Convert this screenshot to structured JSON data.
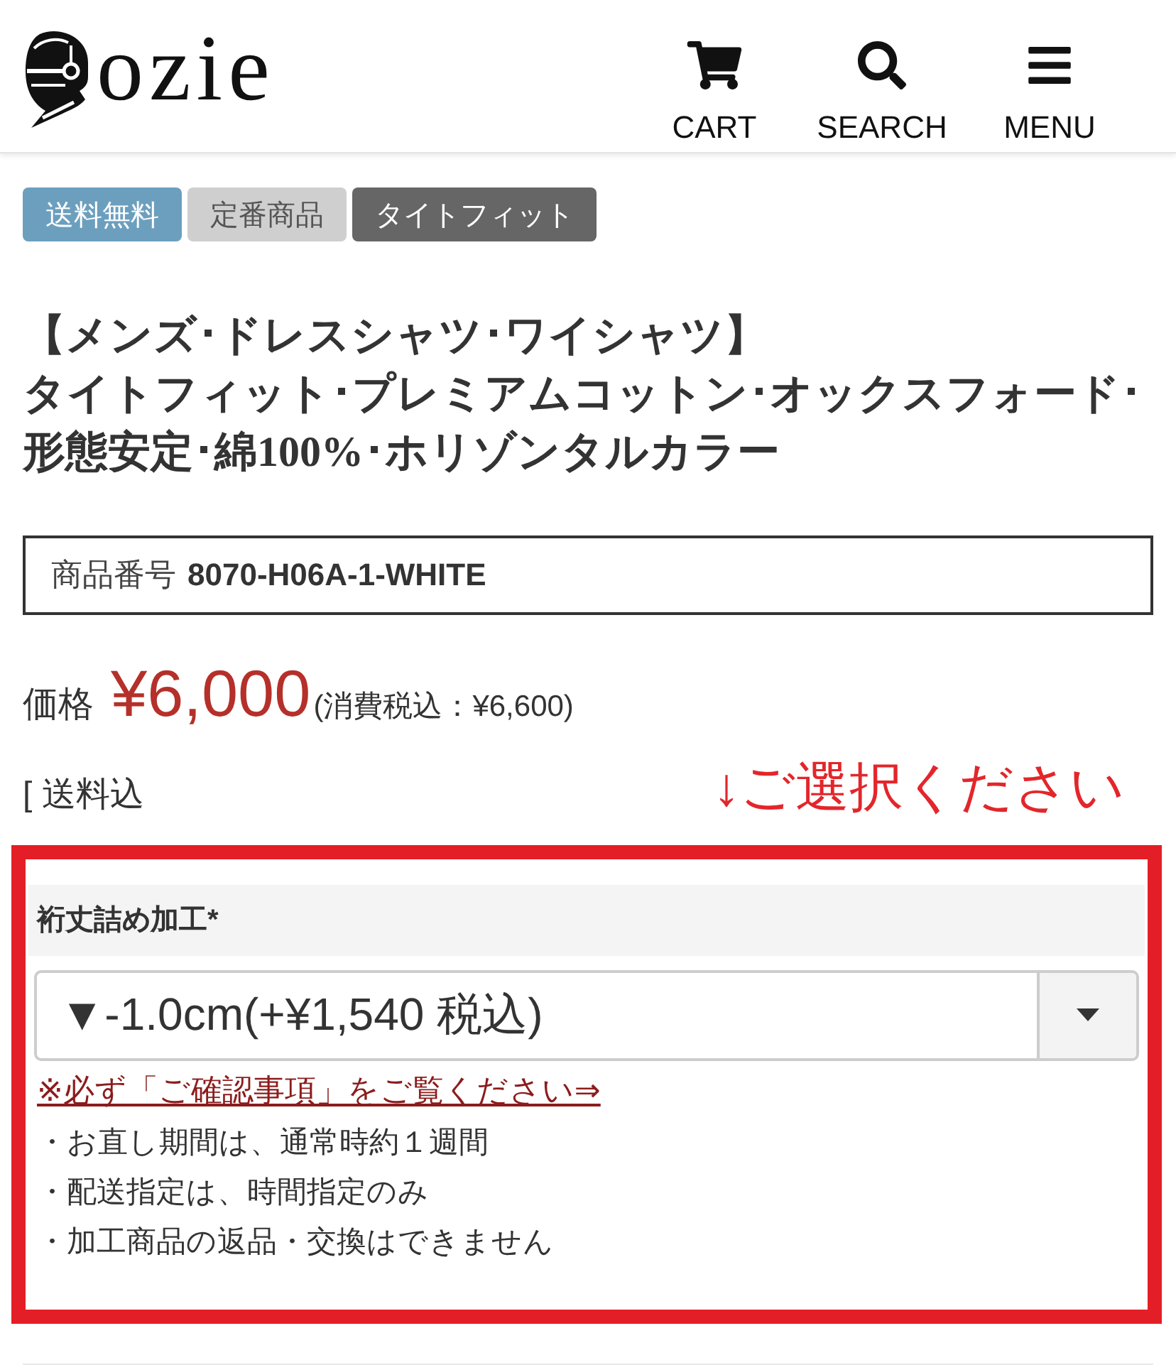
{
  "header": {
    "logo": {
      "text": "ozie"
    },
    "nav": [
      {
        "kind": "cart",
        "label": "CART"
      },
      {
        "kind": "search",
        "label": "SEARCH"
      },
      {
        "kind": "menu",
        "label": "MENU"
      }
    ]
  },
  "tags": [
    {
      "label": "送料無料",
      "color": "#6c9fbe"
    },
    {
      "label": "定番商品",
      "color": "#cfcfcf"
    },
    {
      "label": "タイトフィット",
      "color": "#666666"
    }
  ],
  "product": {
    "title_lines": [
      "【メンズ･ドレスシャツ･ワイシャツ】",
      "タイトフィット･プレミアムコットン･オックスフォード･",
      "形態安定･綿100%･ホリゾンタルカラー"
    ],
    "number": {
      "label": "商品番号",
      "value": "8070-H06A-1-WHITE"
    },
    "price": {
      "label": "価格",
      "amount": "¥6,000",
      "tax_note": "(消費税込：¥6,600)"
    },
    "shipping": "[ 送料込",
    "select_prompt": "↓ご選択ください"
  },
  "option": {
    "label": "裄丈詰め加工*",
    "value": "▼-1.0cm(+¥1,540 税込)",
    "notice_link": "※必ず「ご確認事項」をご覧ください⇒",
    "notes": [
      "・お直し期間は、通常時約１週間",
      "・配送指定は、時間指定のみ",
      "・加工商品の返品・交換はできません"
    ]
  }
}
